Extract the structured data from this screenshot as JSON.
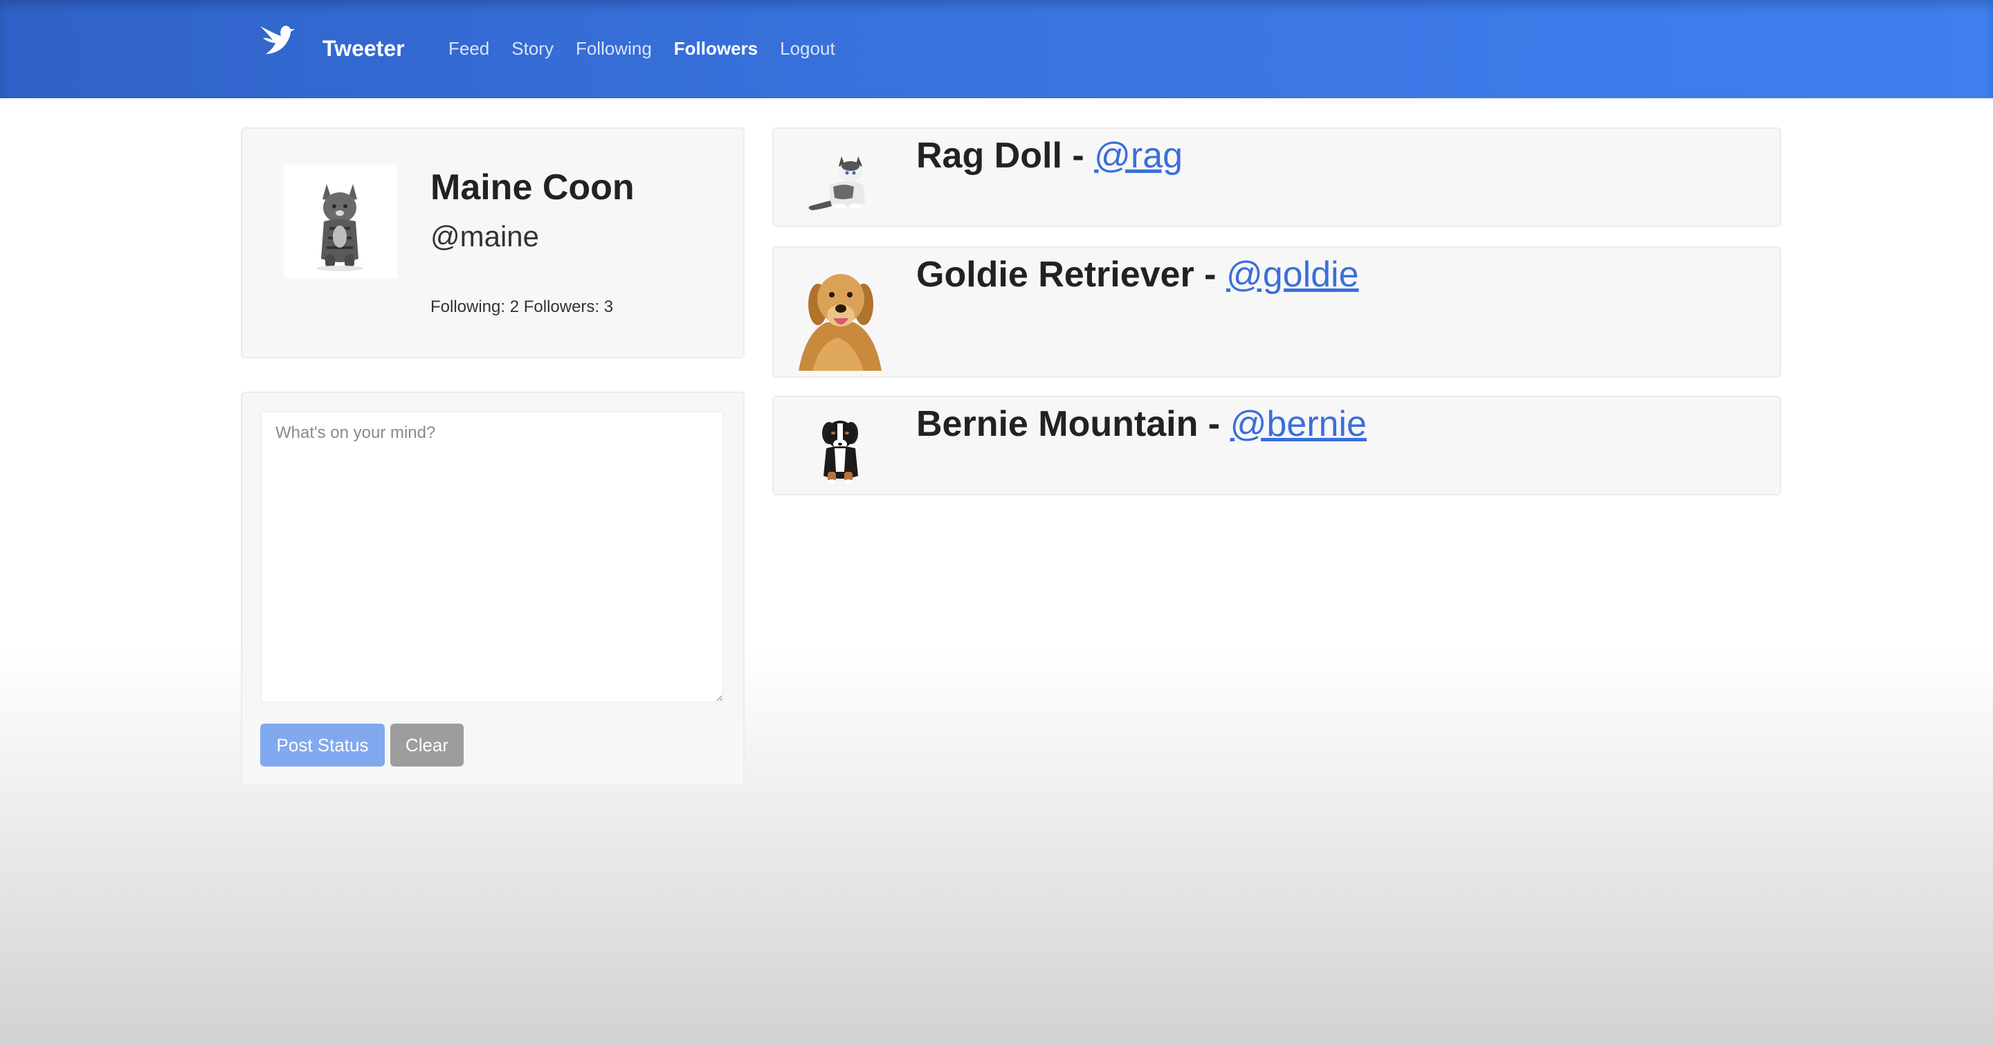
{
  "navbar": {
    "brand": "Tweeter",
    "brand_icon": "bird-logo-icon",
    "links": [
      {
        "label": "Feed"
      },
      {
        "label": "Story"
      },
      {
        "label": "Following"
      },
      {
        "label": "Followers",
        "active": true
      },
      {
        "label": "Logout"
      }
    ]
  },
  "profile": {
    "name": "Maine Coon",
    "handle": "@maine",
    "stats": "Following: 2 Followers: 3",
    "avatar_icon": "maine-coon-cat-photo"
  },
  "compose": {
    "placeholder": "What's on your mind?",
    "value": "",
    "post_label": "Post Status",
    "clear_label": "Clear"
  },
  "followers": [
    {
      "name": "Rag Doll",
      "separator": " - ",
      "handle": "@rag",
      "avatar_icon": "ragdoll-cat-photo"
    },
    {
      "name": "Goldie Retriever",
      "separator": " - ",
      "handle": "@goldie",
      "avatar_icon": "golden-retriever-photo"
    },
    {
      "name": "Bernie Mountain",
      "separator": " - ",
      "handle": "@bernie",
      "avatar_icon": "bernese-mountain-dog-photo"
    }
  ],
  "colors": {
    "navbar": "#3a74e0",
    "link": "#3b6fd8",
    "post_button": "#80a9ef",
    "clear_button": "#9d9d9d"
  }
}
